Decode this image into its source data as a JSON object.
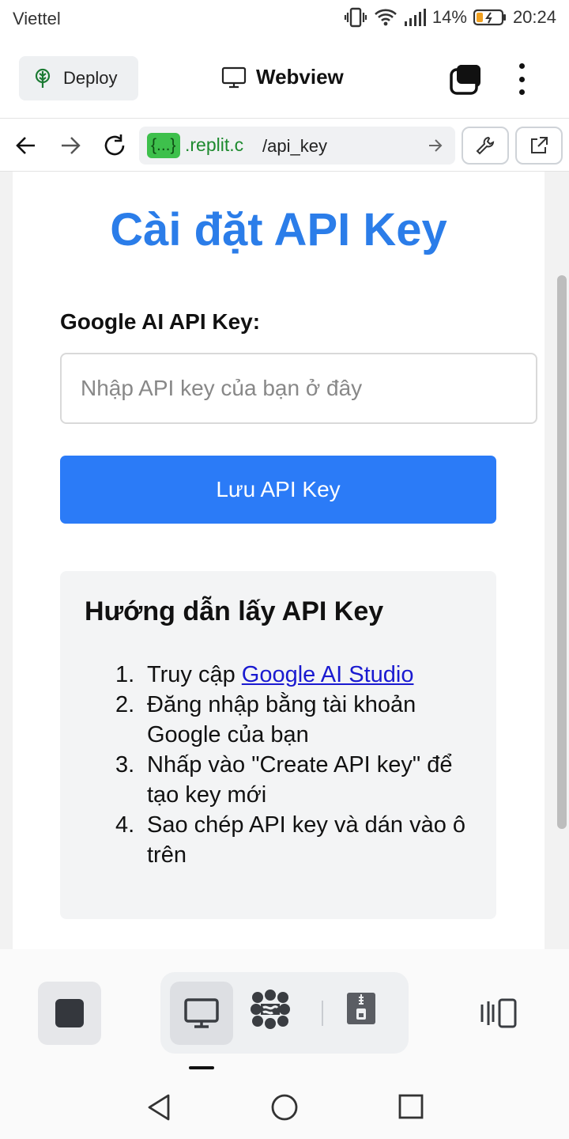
{
  "status_bar": {
    "carrier": "Viettel",
    "battery": "14%",
    "time": "20:24"
  },
  "topbar": {
    "deploy_label": "Deploy",
    "title": "Webview"
  },
  "urlbar": {
    "domain_chip": "{...}",
    "domain": ".replit.c",
    "path": "/api_key"
  },
  "page": {
    "title": "Cài đặt API Key",
    "field_label": "Google AI API Key:",
    "input_placeholder": "Nhập API key của bạn ở đây",
    "input_value": "",
    "save_button": "Lưu API Key",
    "guide": {
      "title": "Hướng dẫn lấy API Key",
      "steps": [
        {
          "num": "1.",
          "prefix": "Truy cập ",
          "link": "Google AI Studio"
        },
        {
          "num": "2.",
          "text": "Đăng nhập bằng tài khoản Google của bạn"
        },
        {
          "num": "3.",
          "text": "Nhấp vào \"Create API key\" để tạo key mới"
        },
        {
          "num": "4.",
          "text": "Sao chép API key và dán vào ô trên"
        }
      ]
    }
  },
  "colors": {
    "accent": "#2b7de9",
    "button": "#2b7bf7",
    "domain_chip": "#3ec04c",
    "link": "#1a1ad0"
  },
  "icons": {
    "deploy": "deploy-tree-icon",
    "webview": "monitor-icon",
    "tabs": "tabs-icon",
    "menu": "kebab-menu-icon",
    "back": "arrow-left-icon",
    "forward": "arrow-right-icon",
    "reload": "reload-icon",
    "go": "arrow-right-icon",
    "devtools": "wrench-icon",
    "open_external": "external-link-icon",
    "stop": "stop-icon",
    "ai": "ai-agent-icon",
    "zip": "zip-archive-icon",
    "panel": "panel-toggle-icon"
  }
}
